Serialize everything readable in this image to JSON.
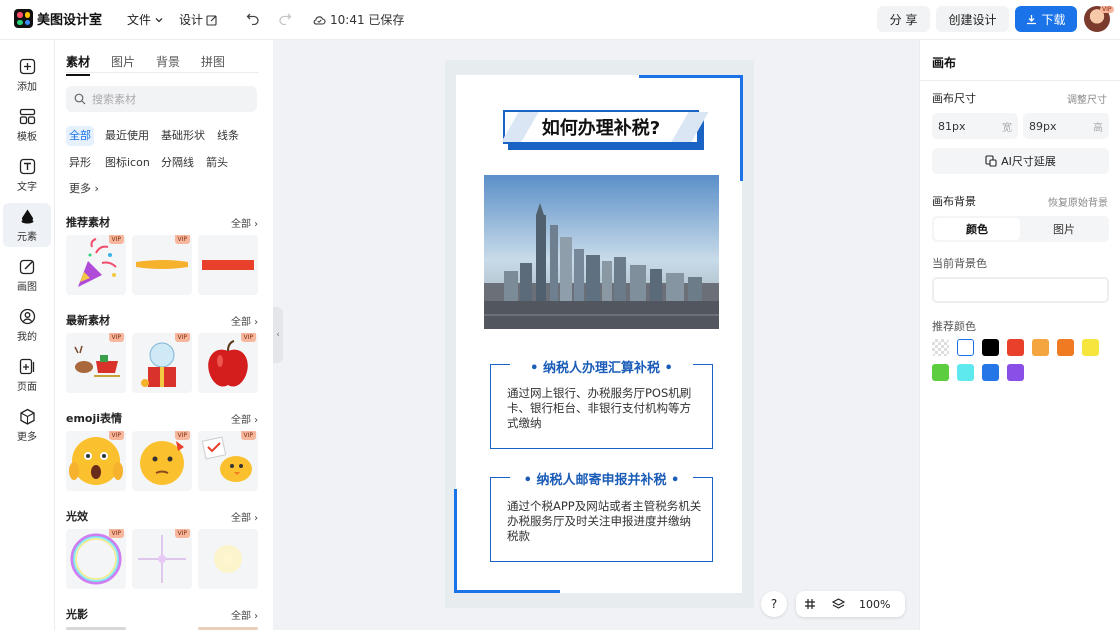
{
  "topbar": {
    "app_name": "美图设计室",
    "menu_file": "文件",
    "menu_design": "设计",
    "save_status": "10:41 已保存",
    "share": "分 享",
    "create_design": "创建设计",
    "download": "下载",
    "avatar_badge": "VIP"
  },
  "leftnav": [
    {
      "label": "添加",
      "icon": "plus-square-icon"
    },
    {
      "label": "模板",
      "icon": "template-icon"
    },
    {
      "label": "文字",
      "icon": "text-icon"
    },
    {
      "label": "元素",
      "icon": "shapes-icon"
    },
    {
      "label": "画图",
      "icon": "draw-icon"
    },
    {
      "label": "我的",
      "icon": "user-icon"
    },
    {
      "label": "页面",
      "icon": "page-icon"
    },
    {
      "label": "更多",
      "icon": "cube-icon"
    }
  ],
  "panel": {
    "tabs": [
      "素材",
      "图片",
      "背景",
      "拼图"
    ],
    "search_placeholder": "搜索素材",
    "chips": [
      "全部",
      "最近使用",
      "基础形状",
      "线条",
      "异形",
      "图标icon",
      "分隔线",
      "箭头",
      "更多"
    ],
    "vip_label": "VIP",
    "all_label": "全部",
    "sections": [
      {
        "title": "推荐素材"
      },
      {
        "title": "最新素材"
      },
      {
        "title": "emoji表情"
      },
      {
        "title": "光效"
      },
      {
        "title": "光影"
      }
    ]
  },
  "canvas": {
    "title": "如何办理补税?",
    "card1_title": "• 纳税人办理汇算补税 •",
    "card1_body": "通过网上银行、办税服务厅POS机刷卡、银行柜台、非银行支付机构等方式缴纳",
    "card2_title": "• 纳税人邮寄申报并补税 •",
    "card2_body": "通过个税APP及网站或者主管税务机关办税服务厅及时关注申报进度并缴纳税款",
    "zoom": "100%",
    "help": "?"
  },
  "right": {
    "title": "画布",
    "size_label": "画布尺寸",
    "size_adjust": "调整尺寸",
    "width_value": "81px",
    "width_unit": "宽",
    "height_value": "89px",
    "height_unit": "高",
    "ai_extend": "AI尺寸延展",
    "bg_label": "画布背景",
    "bg_reset": "恢复原始背景",
    "seg_color": "颜色",
    "seg_image": "图片",
    "current_bg": "当前背景色",
    "recommended": "推荐颜色",
    "swatches": [
      "transparent",
      "#ffffff",
      "#000000",
      "#e8402a",
      "#f4a540",
      "#f07a22",
      "#f5e53d",
      "#5ccd3f",
      "#5ee9ee",
      "#2577e8",
      "#8a4fe6"
    ]
  },
  "colors": {
    "accent": "#1a73e8",
    "canvas_blue": "#1a62c4"
  }
}
